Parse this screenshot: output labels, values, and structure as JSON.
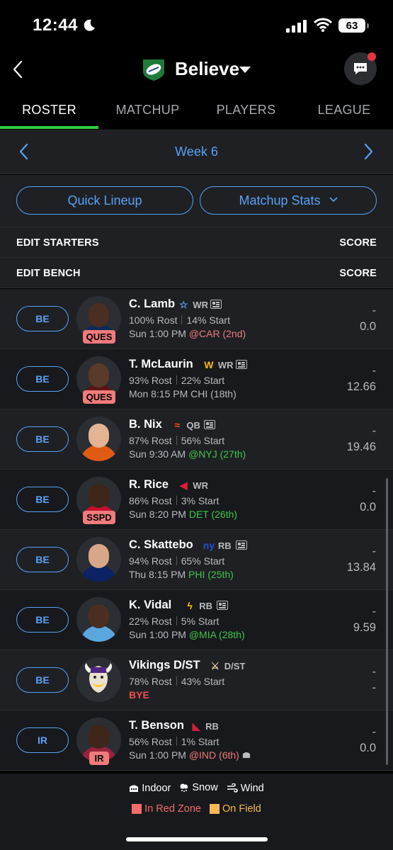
{
  "status_bar": {
    "time": "12:44",
    "battery": "63"
  },
  "header": {
    "team_name": "Believe"
  },
  "tabs": [
    {
      "label": "ROSTER"
    },
    {
      "label": "MATCHUP"
    },
    {
      "label": "PLAYERS"
    },
    {
      "label": "LEAGUE"
    }
  ],
  "week_nav": {
    "label": "Week 6"
  },
  "actions": {
    "quick_lineup": "Quick Lineup",
    "matchup_stats": "Matchup Stats"
  },
  "sections": {
    "starters": {
      "label": "EDIT STARTERS",
      "score": "SCORE"
    },
    "bench": {
      "label": "EDIT BENCH",
      "score": "SCORE"
    }
  },
  "players": [
    {
      "slot": "BE",
      "name": "C. Lamb",
      "team_icon": "star-icon",
      "position": "WR",
      "news": true,
      "injury": "QUES",
      "rost": "100% Rost",
      "start": "14% Start",
      "game_time": "Sun 1:00 PM",
      "opponent": "@CAR (2nd)",
      "opp_color": "#f07b7b",
      "score_top": "-",
      "score": "0.0",
      "skin": "#4a2e22",
      "jersey": "#0b2a5b"
    },
    {
      "slot": "BE",
      "name": "T. McLaurin",
      "team_icon": "commanders-icon",
      "position": "WR",
      "news": true,
      "injury": "QUES",
      "rost": "93% Rost",
      "start": "22% Start",
      "game_time": "Mon 8:15 PM",
      "opponent": "CHI (18th)",
      "opp_color": "#b9bbbf",
      "score_top": "-",
      "score": "12.66",
      "skin": "#5a3a28",
      "jersey": "#5a1414"
    },
    {
      "slot": "BE",
      "name": "B. Nix",
      "team_icon": "broncos-icon",
      "position": "QB",
      "news": true,
      "injury": "",
      "rost": "87% Rost",
      "start": "56% Start",
      "game_time": "Sun 9:30 AM",
      "opponent": "@NYJ (27th)",
      "opp_color": "#3fc74a",
      "score_top": "-",
      "score": "19.46",
      "skin": "#e2b494",
      "jersey": "#e05a14"
    },
    {
      "slot": "BE",
      "name": "R. Rice",
      "team_icon": "chiefs-icon",
      "position": "WR",
      "news": false,
      "injury": "SSPD",
      "rost": "86% Rost",
      "start": "3% Start",
      "game_time": "Sun 8:20 PM",
      "opponent": "DET (26th)",
      "opp_color": "#3fc74a",
      "score_top": "-",
      "score": "0.0",
      "skin": "#3e261b",
      "jersey": "#c8102e"
    },
    {
      "slot": "BE",
      "name": "C. Skattebo",
      "team_icon": "giants-icon",
      "position": "RB",
      "news": true,
      "injury": "",
      "rost": "94% Rost",
      "start": "65% Start",
      "game_time": "Thu 8:15 PM",
      "opponent": "PHI (25th)",
      "opp_color": "#3fc74a",
      "score_top": "-",
      "score": "13.84",
      "skin": "#d8a688",
      "jersey": "#0b2265"
    },
    {
      "slot": "BE",
      "name": "K. Vidal",
      "team_icon": "chargers-icon",
      "position": "RB",
      "news": true,
      "injury": "",
      "rost": "22% Rost",
      "start": "5% Start",
      "game_time": "Sun 1:00 PM",
      "opponent": "@MIA (28th)",
      "opp_color": "#3fc74a",
      "score_top": "-",
      "score": "9.59",
      "skin": "#4a2e22",
      "jersey": "#5aa7e0"
    },
    {
      "slot": "BE",
      "name": "Vikings D/ST",
      "team_icon": "vikings-icon",
      "position": "D/ST",
      "news": false,
      "injury": "",
      "rost": "78% Rost",
      "start": "43% Start",
      "game_time": "",
      "opponent": "BYE",
      "opp_color": "#f24e4e",
      "score_top": "-",
      "score": "-",
      "skin": "",
      "jersey": ""
    },
    {
      "slot": "IR",
      "name": "T. Benson",
      "team_icon": "cardinals-icon",
      "position": "RB",
      "news": false,
      "injury": "IR",
      "rost": "56% Rost",
      "start": "1% Start",
      "game_time": "Sun 1:00 PM",
      "opponent": "@IND (6th)",
      "opp_color": "#f07b7b",
      "score_top": "-",
      "score": "0.0",
      "skin": "#3e261b",
      "jersey": "#97233f"
    }
  ],
  "legend": {
    "indoor": "Indoor",
    "snow": "Snow",
    "wind": "Wind",
    "red_zone": "In Red Zone",
    "on_field": "On Field",
    "red_zone_color": "#f46b6b",
    "on_field_color": "#f7b955"
  }
}
